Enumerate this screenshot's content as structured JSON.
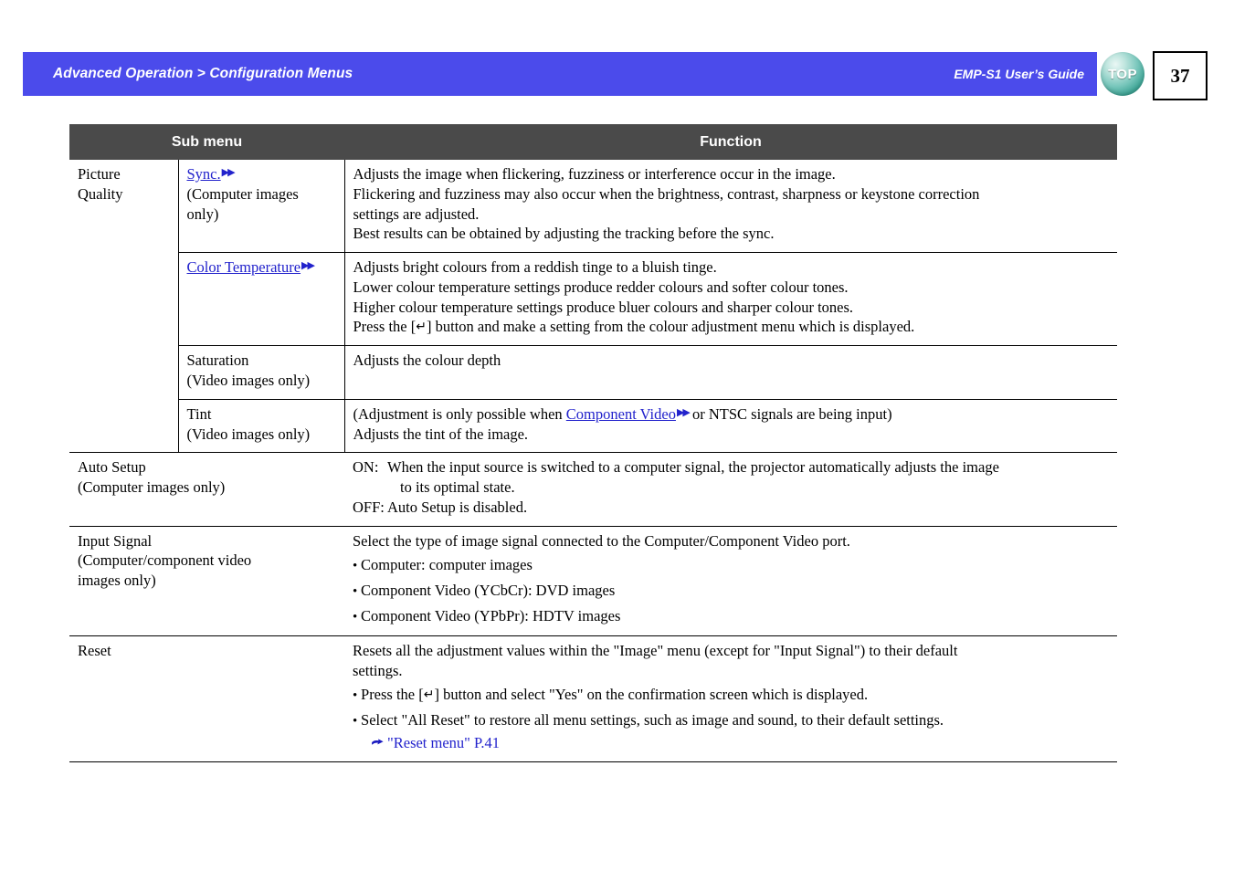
{
  "header": {
    "breadcrumb": "Advanced Operation > Configuration Menus",
    "guide_title": "EMP-S1 User’s Guide",
    "top_button_label": "TOP",
    "page_number": "37",
    "bar_color": "#4b4beb",
    "top_button_color": "#3fa596"
  },
  "table": {
    "headers": {
      "sub_menu": "Sub menu",
      "function": "Function"
    },
    "group_picture_quality": {
      "label_line1": "Picture",
      "label_line2": "Quality"
    },
    "rows": [
      {
        "sub2_link": "Sync.",
        "sub2_note": "(Computer images",
        "sub2_note2": "only)",
        "func_lines": [
          "Adjusts the image when flickering, fuzziness or interference occur in the image.",
          "Flickering and fuzziness may also occur when the brightness, contrast, sharpness or keystone correction",
          "settings are adjusted.",
          "Best results can be obtained by adjusting the tracking before the sync."
        ]
      },
      {
        "sub2_link": "Color Temperature",
        "func_lines": [
          "Adjusts bright colours from a reddish tinge to a bluish tinge.",
          "Lower colour temperature settings produce redder colours and softer colour tones.",
          "Higher colour temperature settings produce bluer colours and sharper colour tones."
        ],
        "func_press_pre": "Press the [",
        "func_press_key": "↵",
        "func_press_post": "] button and make a setting from the colour adjustment menu which is displayed."
      },
      {
        "sub2_title": "Saturation",
        "sub2_note": "(Video images only)",
        "func_lines": [
          "Adjusts the colour depth"
        ]
      },
      {
        "sub2_title": "Tint",
        "sub2_note": "(Video images only)",
        "func_pre": "(Adjustment is only possible when ",
        "func_link": "Component Video",
        "func_post": " or NTSC signals are being input)",
        "func_line2": "Adjusts the tint of the image."
      }
    ],
    "auto_setup": {
      "title": "Auto Setup",
      "note": "(Computer images only)",
      "on_label": "ON:",
      "on_text": "When the input source is switched to a computer signal, the projector automatically adjusts the image",
      "on_text_cont": "to its optimal state.",
      "off_label": "OFF:",
      "off_text": "Auto Setup is disabled."
    },
    "input_signal": {
      "title": "Input Signal",
      "note_line1": "(Computer/component video",
      "note_line2": "images only)",
      "intro": "Select the type of image signal connected to the Computer/Component Video port.",
      "bullets": [
        "Computer: computer images",
        "Component Video (YCbCr): DVD images",
        "Component Video (YPbPr): HDTV images"
      ]
    },
    "reset": {
      "title": "Reset",
      "intro_line1": "Resets all the adjustment values within the \"Image\" menu  (except for \"Input Signal\") to their default",
      "intro_line2": "settings.",
      "bullet1_pre": "Press the [",
      "bullet1_key": "↵",
      "bullet1_post": "] button and select \"Yes\" on the confirmation screen which is displayed.",
      "bullet2": "Select \"All Reset\" to restore all menu settings, such as image and sound, to their default settings.",
      "reference_link": "\"Reset menu\" P.41"
    }
  }
}
